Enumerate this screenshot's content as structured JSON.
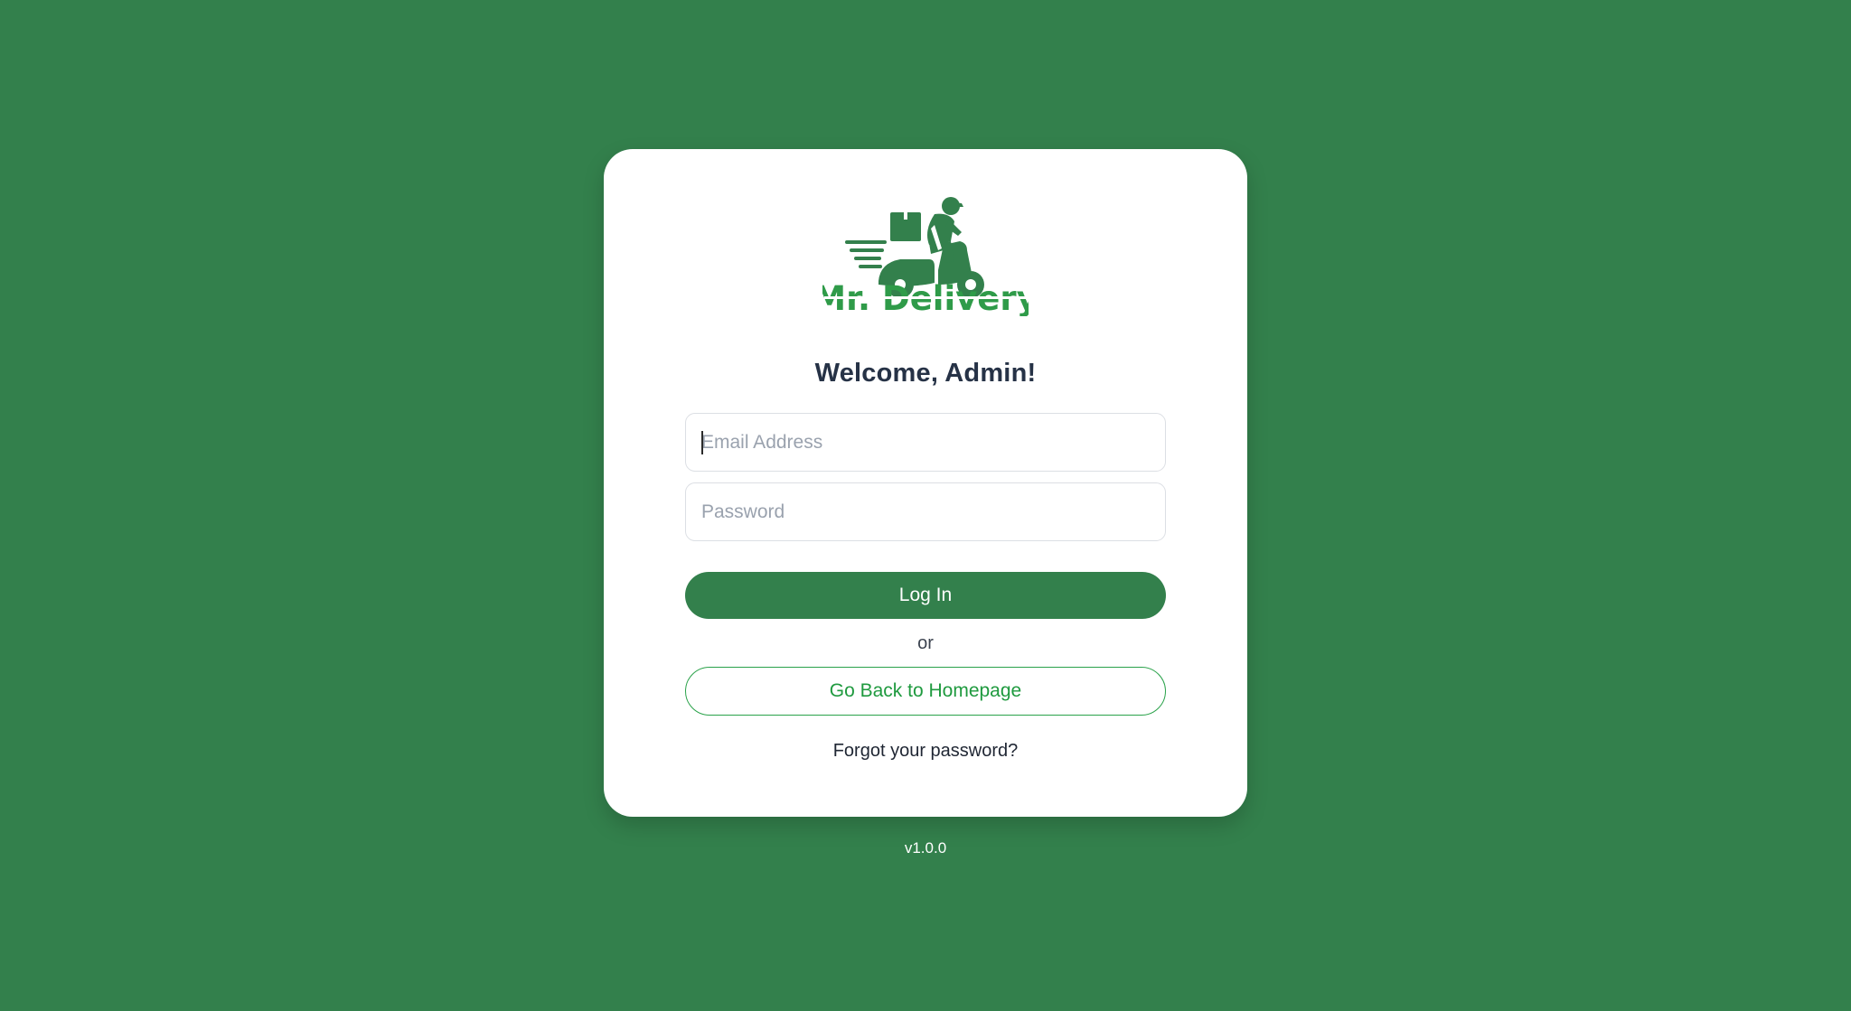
{
  "brand": {
    "name": "Mr. Delivery",
    "color": "#33804c",
    "wordmark_color": "#2f9b49"
  },
  "login": {
    "heading": "Welcome, Admin!",
    "email_placeholder": "Email Address",
    "email_value": "",
    "password_placeholder": "Password",
    "password_value": "",
    "login_label": "Log In",
    "divider_text": "or",
    "home_label": "Go Back to Homepage",
    "forgot_label": "Forgot your password?"
  },
  "footer": {
    "version": "v1.0.0"
  },
  "icons": {
    "logo": "delivery-scooter-icon"
  }
}
